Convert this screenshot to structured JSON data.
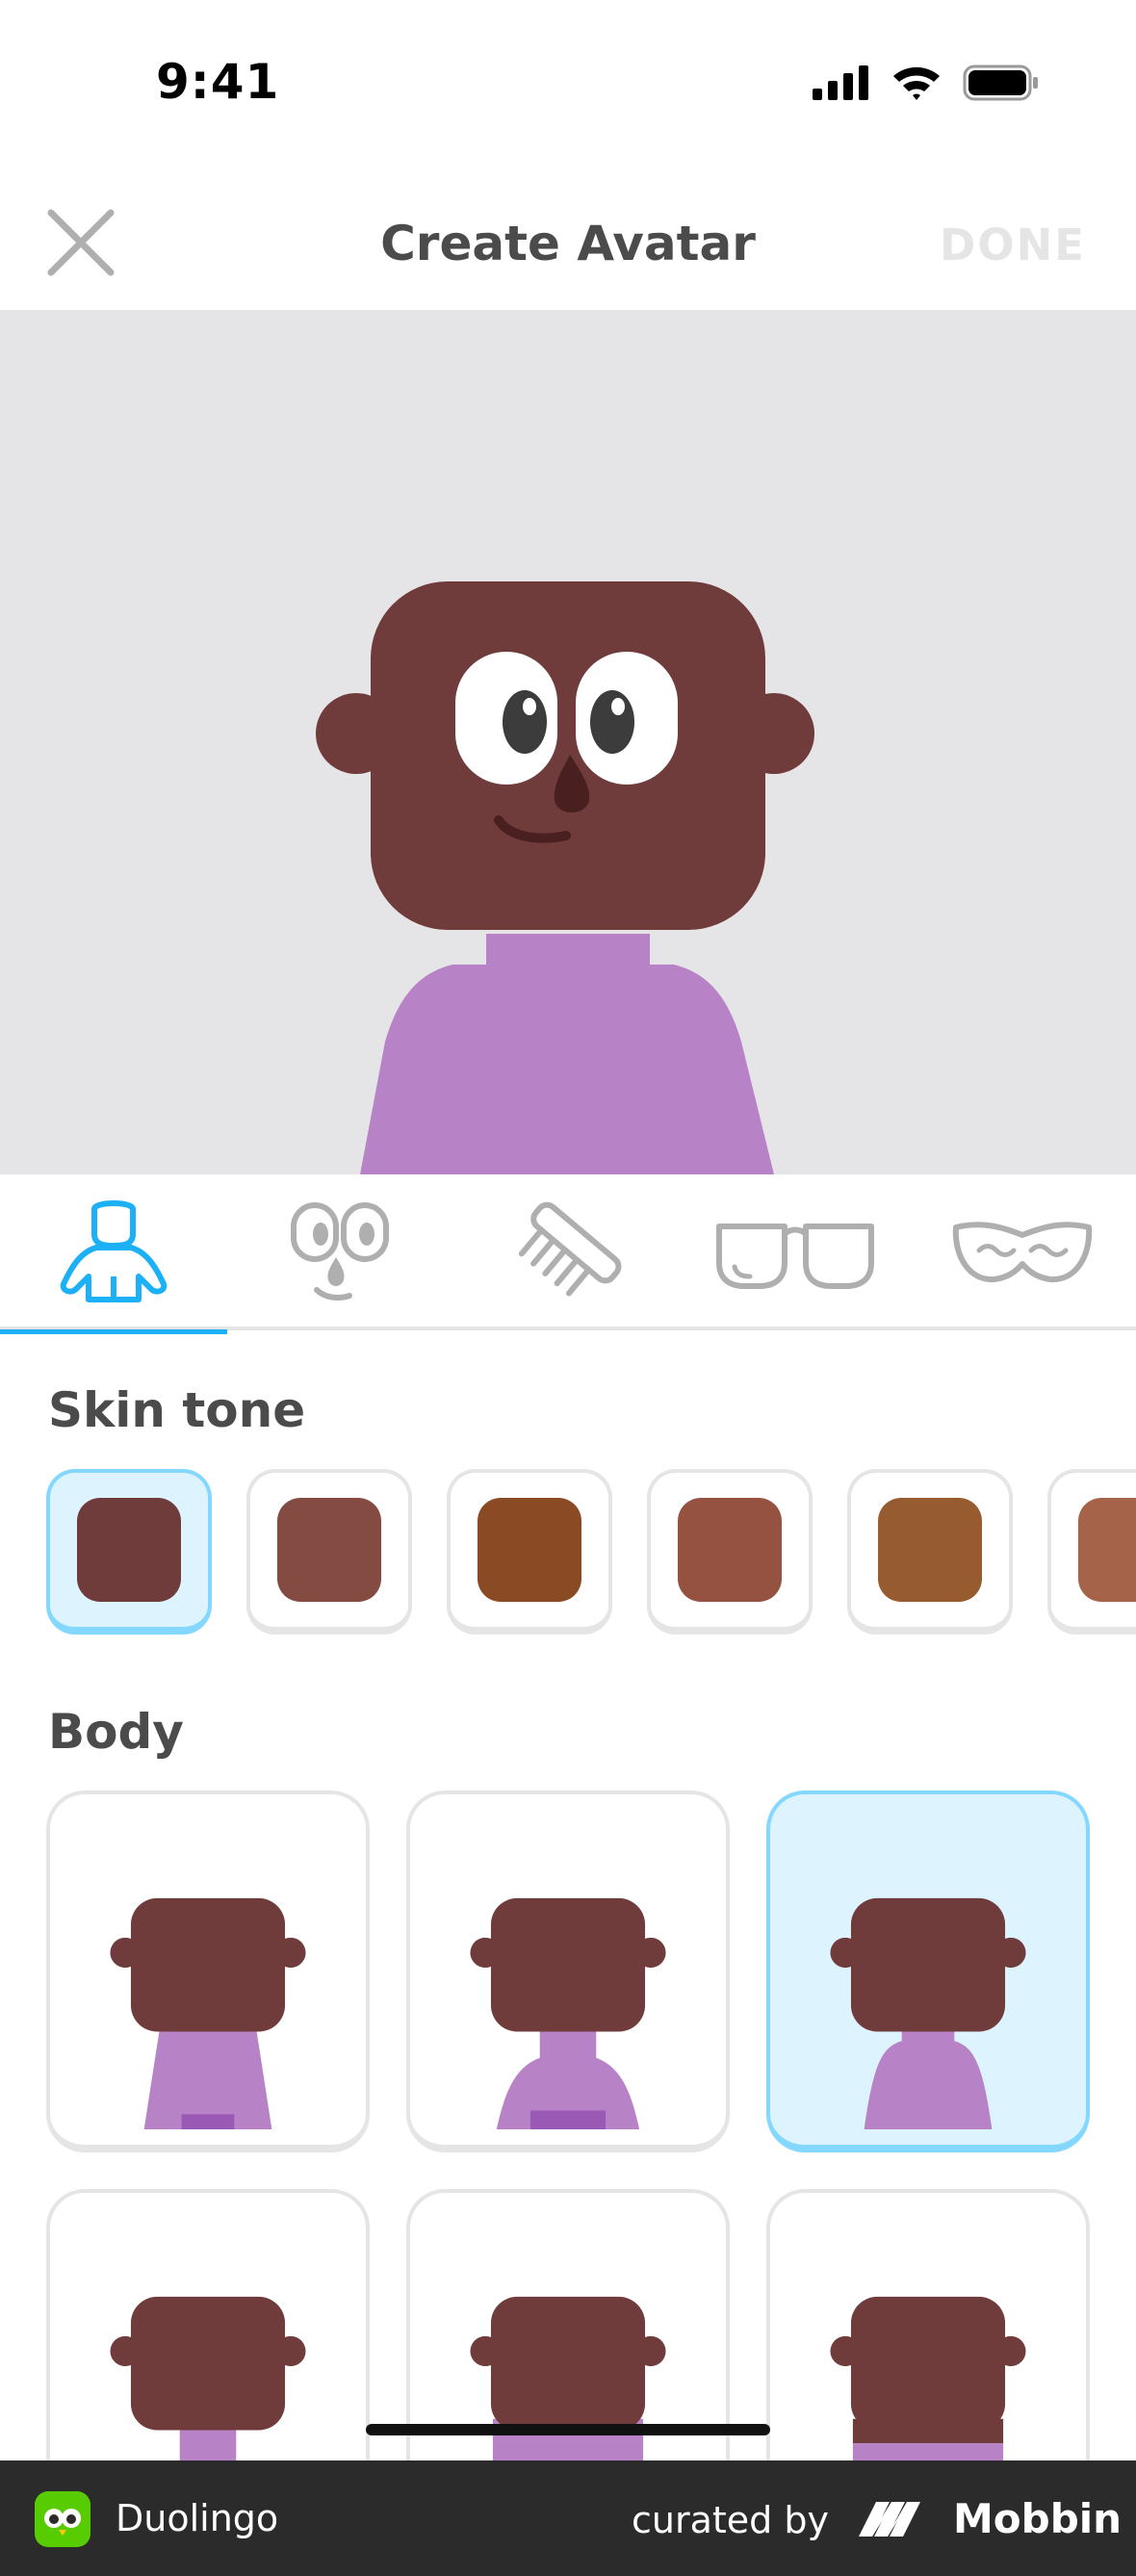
{
  "status_bar": {
    "time": "9:41"
  },
  "nav": {
    "title": "Create Avatar",
    "done_label": "DONE"
  },
  "tabs": [
    {
      "name": "body",
      "selected": true
    },
    {
      "name": "face",
      "selected": false
    },
    {
      "name": "hair",
      "selected": false
    },
    {
      "name": "glasses",
      "selected": false
    },
    {
      "name": "facial-hair",
      "selected": false
    }
  ],
  "sections": {
    "skin_tone": "Skin tone",
    "body": "Body"
  },
  "skin_tones": [
    {
      "color": "#6f3b3b",
      "selected": true
    },
    {
      "color": "#834b42",
      "selected": false
    },
    {
      "color": "#8a4a24",
      "selected": false
    },
    {
      "color": "#955240",
      "selected": false
    },
    {
      "color": "#975b30",
      "selected": false
    },
    {
      "color": "#a5644a",
      "selected": false
    }
  ],
  "body_options": [
    {
      "selected": false
    },
    {
      "selected": false
    },
    {
      "selected": true
    },
    {
      "selected": false
    },
    {
      "selected": false
    },
    {
      "selected": false
    }
  ],
  "colors": {
    "accent": "#1cb0f6",
    "selected_border": "#84d8ff",
    "selected_fill": "#ddf4ff",
    "skin": "#6f3b3b",
    "shirt": "#b883c6"
  },
  "footer": {
    "app_name": "Duolingo",
    "curated_by": "curated by",
    "brand": "Mobbin"
  }
}
